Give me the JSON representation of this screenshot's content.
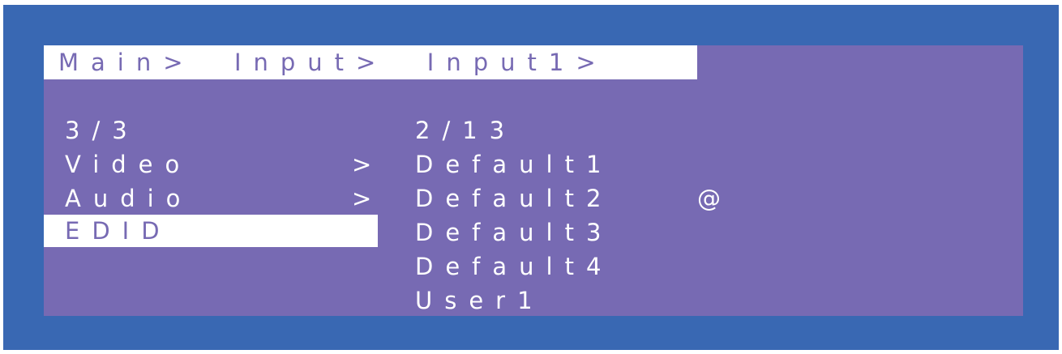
{
  "breadcrumb": "Main>  Input>  Input1>",
  "left_column": {
    "page_counter": "3/3",
    "items": [
      {
        "label": "Video",
        "arrow": ">"
      },
      {
        "label": "Audio",
        "arrow": ">"
      },
      {
        "label": "EDID",
        "arrow": ">",
        "selected": true
      }
    ]
  },
  "right_column": {
    "page_counter": "2/13",
    "items": [
      {
        "label": "Default1",
        "marker": ""
      },
      {
        "label": "Default2",
        "marker": "@"
      },
      {
        "label": "Default3",
        "marker": ""
      },
      {
        "label": "Default4",
        "marker": ""
      },
      {
        "label": "User1",
        "marker": ""
      }
    ]
  },
  "colors": {
    "bezel": "#3968b3",
    "screen": "#776ab3",
    "text": "#ffffff",
    "highlight": "#ffffff"
  }
}
